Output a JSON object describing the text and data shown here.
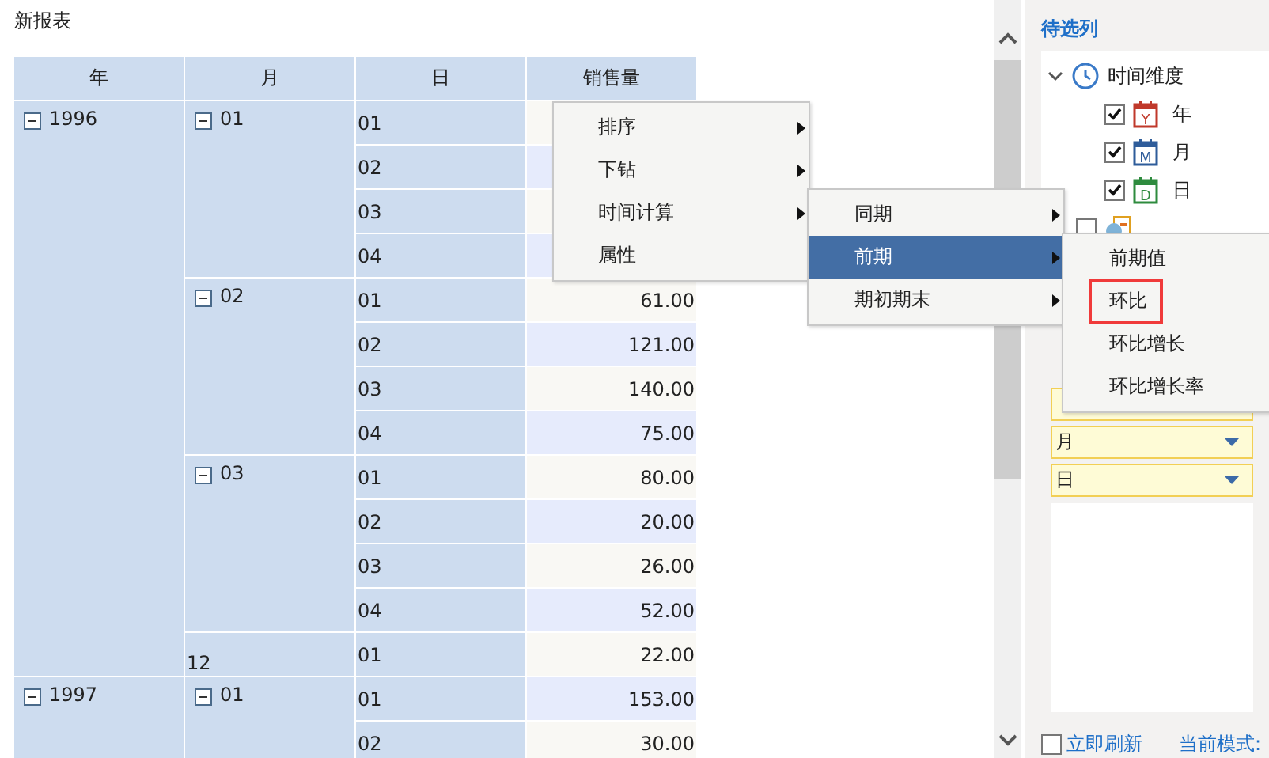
{
  "report_title": "新报表",
  "table": {
    "columns": [
      "年",
      "月",
      "日",
      "销售量"
    ],
    "years": [
      {
        "label": "1996",
        "expanded": true,
        "months": [
          {
            "label": "01",
            "has_toggle": true,
            "days": [
              {
                "label": "01"
              },
              {
                "label": "02"
              },
              {
                "label": "03"
              },
              {
                "label": "04"
              }
            ]
          },
          {
            "label": "02",
            "has_toggle": true,
            "days": [
              {
                "label": "01",
                "value": "61.00"
              },
              {
                "label": "02",
                "value": "121.00"
              },
              {
                "label": "03",
                "value": "140.00"
              },
              {
                "label": "04",
                "value": "75.00"
              }
            ]
          },
          {
            "label": "03",
            "has_toggle": true,
            "days": [
              {
                "label": "01",
                "value": "80.00"
              },
              {
                "label": "02",
                "value": "20.00"
              },
              {
                "label": "03",
                "value": "26.00"
              },
              {
                "label": "04",
                "value": "52.00"
              }
            ]
          },
          {
            "label": "12",
            "has_toggle": false,
            "days": [
              {
                "label": "01",
                "value": "22.00"
              }
            ]
          }
        ]
      },
      {
        "label": "1997",
        "expanded": true,
        "months": [
          {
            "label": "01",
            "has_toggle": true,
            "days": [
              {
                "label": "01",
                "value": "153.00"
              },
              {
                "label": "02",
                "value": "30.00"
              }
            ]
          }
        ]
      }
    ]
  },
  "side_panel": {
    "title": "待选列",
    "tree": [
      {
        "label": "时间维度",
        "expanded": true,
        "children": [
          {
            "label": "年",
            "checked": true,
            "icon_letter": "Y",
            "color": "#c0392b"
          },
          {
            "label": "月",
            "checked": true,
            "icon_letter": "M",
            "color": "#2e5c9a"
          },
          {
            "label": "日",
            "checked": true,
            "icon_letter": "D",
            "color": "#2e8b3e"
          }
        ]
      },
      {
        "checked": false
      }
    ],
    "row_fields": [
      {
        "value": "月"
      },
      {
        "value": "日"
      }
    ],
    "refresh_checkbox": {
      "label": "立即刷新",
      "checked": false
    },
    "mode_label": "当前模式:"
  },
  "context_menu": [
    {
      "label": "排序",
      "has_submenu": true
    },
    {
      "label": "下钻",
      "has_submenu": true
    },
    {
      "label": "时间计算",
      "has_submenu": true
    },
    {
      "label": "属性",
      "has_submenu": false
    }
  ],
  "submenu": [
    {
      "label": "同期",
      "selected": false
    },
    {
      "label": "前期",
      "selected": true
    },
    {
      "label": "期初期末",
      "selected": false
    }
  ],
  "submenu_2": [
    {
      "label": "前期值",
      "marked": false
    },
    {
      "label": "环比",
      "marked": true
    },
    {
      "label": "环比增长",
      "marked": false
    },
    {
      "label": "环比增长率",
      "marked": false
    }
  ]
}
